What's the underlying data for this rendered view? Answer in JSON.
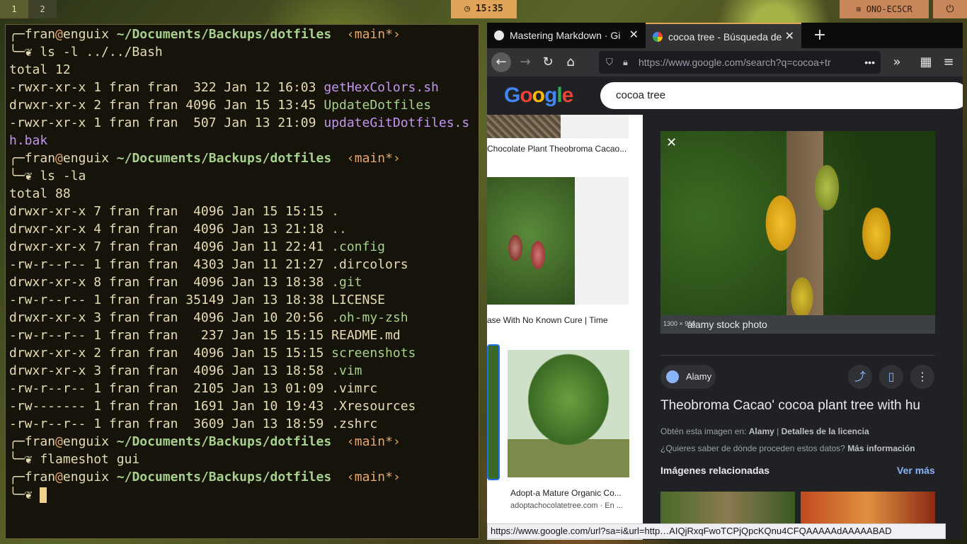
{
  "topbar": {
    "workspaces": [
      "1",
      "2"
    ],
    "clock_icon": "clock-icon",
    "clock": "15:35",
    "wifi_icon": "wifi-icon",
    "network": "ONO-EC5CR",
    "power_icon": "power-icon"
  },
  "terminal": {
    "prompt": {
      "user": "fran",
      "at": "@",
      "host": "enguix",
      "path": "~/Documents/Backups/dotfiles",
      "branch": "‹main*›"
    },
    "commands": [
      "ls -l ../../Bash",
      "ls -la",
      "flameshot gui"
    ],
    "total1": "total 12",
    "ls1": [
      {
        "meta": "-rwxr-xr-x 1 fran fran  322 Jan 12 16:03 ",
        "name": "getHexColors.sh",
        "kind": "exe"
      },
      {
        "meta": "drwxr-xr-x 2 fran fran 4096 Jan 15 13:45 ",
        "name": "UpdateDotfiles",
        "kind": "dir"
      },
      {
        "meta": "-rwxr-xr-x 1 fran fran  507 Jan 13 21:09 ",
        "name": "updateGitDotfiles.s",
        "kind": "exe"
      }
    ],
    "ls1_wrap": "h.bak",
    "total2": "total 88",
    "ls2": [
      {
        "meta": "drwxr-xr-x 7 fran fran  4096 Jan 15 15:15 ",
        "name": ".",
        "kind": "dir"
      },
      {
        "meta": "drwxr-xr-x 4 fran fran  4096 Jan 13 21:18 ",
        "name": "..",
        "kind": "dir"
      },
      {
        "meta": "drwxr-xr-x 7 fran fran  4096 Jan 11 22:41 ",
        "name": ".config",
        "kind": "dir"
      },
      {
        "meta": "-rw-r--r-- 1 fran fran  4303 Jan 11 21:27 ",
        "name": ".dircolors",
        "kind": "file"
      },
      {
        "meta": "drwxr-xr-x 8 fran fran  4096 Jan 13 18:38 ",
        "name": ".git",
        "kind": "dir"
      },
      {
        "meta": "-rw-r--r-- 1 fran fran 35149 Jan 13 18:38 ",
        "name": "LICENSE",
        "kind": "file"
      },
      {
        "meta": "drwxr-xr-x 3 fran fran  4096 Jan 10 20:56 ",
        "name": ".oh-my-zsh",
        "kind": "dir"
      },
      {
        "meta": "-rw-r--r-- 1 fran fran   237 Jan 15 15:15 ",
        "name": "README.md",
        "kind": "file"
      },
      {
        "meta": "drwxr-xr-x 2 fran fran  4096 Jan 15 15:15 ",
        "name": "screenshots",
        "kind": "dir"
      },
      {
        "meta": "drwxr-xr-x 3 fran fran  4096 Jan 13 18:58 ",
        "name": ".vim",
        "kind": "dir"
      },
      {
        "meta": "-rw-r--r-- 1 fran fran  2105 Jan 13 01:09 ",
        "name": ".vimrc",
        "kind": "file"
      },
      {
        "meta": "-rw------- 1 fran fran  1691 Jan 10 19:43 ",
        "name": ".Xresources",
        "kind": "file"
      },
      {
        "meta": "-rw-r--r-- 1 fran fran  3609 Jan 13 18:59 ",
        "name": ".zshrc",
        "kind": "file"
      }
    ]
  },
  "browser": {
    "tabs": [
      {
        "label": "Mastering Markdown · Gi",
        "close": "✕"
      },
      {
        "label": "cocoa tree - Búsqueda de",
        "close": "✕"
      }
    ],
    "newtab": "+",
    "url_host": "https://www.google.com",
    "url_path": "/search?q=cocoa+tr",
    "url_more": "•••",
    "page": {
      "logo": "Google",
      "search_value": "cocoa tree",
      "results": [
        "Chocolate Plant Theobroma Cacao...",
        "ase With No Known Cure | Time",
        "Adopt-a Mature Organic Co...",
        "adoptachocolatetree.com · En ..."
      ],
      "panel": {
        "image_size": "1300 × 956",
        "image_source_label": "alamy stock photo",
        "source_chip": "Alamy",
        "title": "Theobroma Cacao' cocoa plant tree with hu",
        "license_prefix": "Obtén esta imagen en:",
        "license_site": "Alamy",
        "license_sep": "|",
        "license_details": "Detalles de la licencia",
        "data_question": "¿Quieres saber de dónde proceden estos datos?",
        "data_more": "Más información",
        "related": "Imágenes relacionadas",
        "see_more": "Ver más"
      }
    },
    "status_url": "https://www.google.com/url?sa=i&url=http…AIQjRxqFwoTCPjQpcKQnu4CFQAAAAAdAAAAABAD"
  },
  "colors": {
    "accent": "#e0a458",
    "dir": "#a8d08d",
    "exe": "#c394f2",
    "terminal_bg": "#15130a",
    "google_blue": "#8ab4f8"
  }
}
